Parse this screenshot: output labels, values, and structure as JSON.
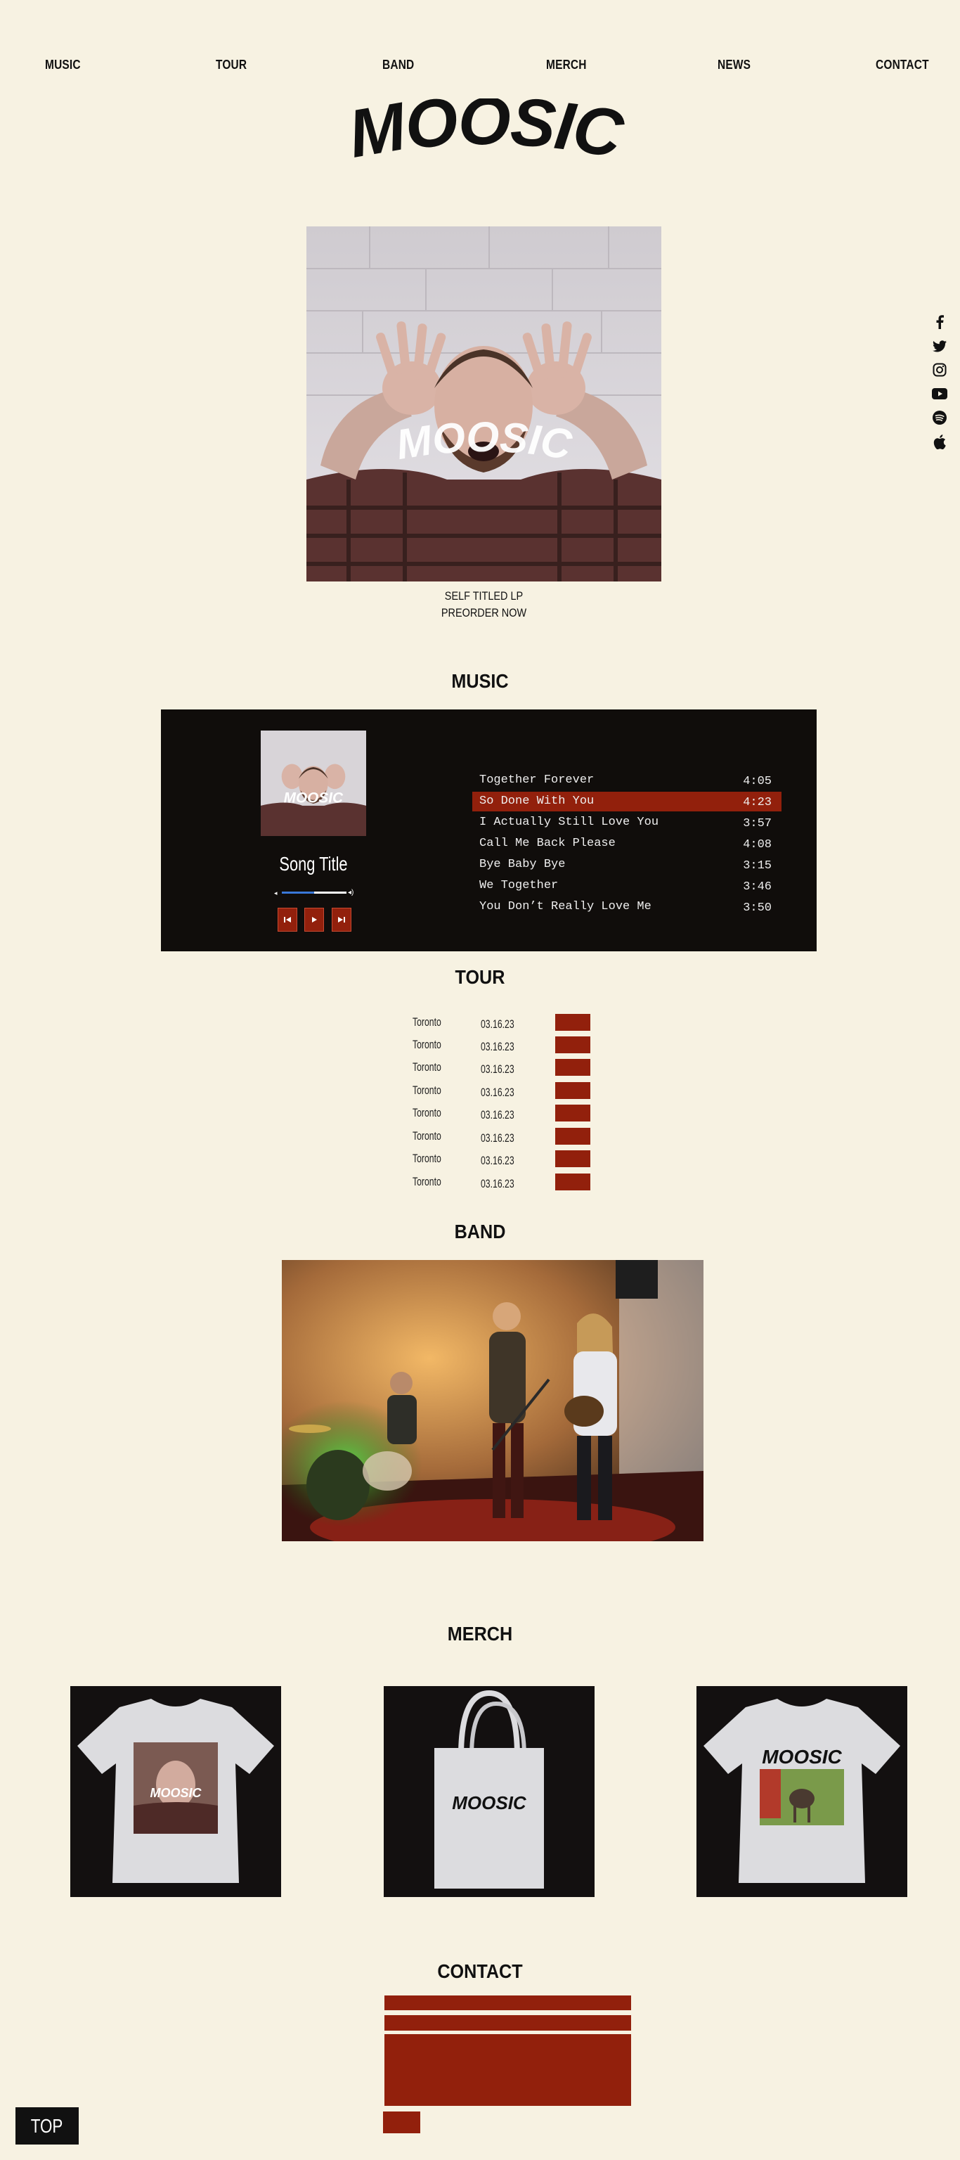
{
  "nav": {
    "items": [
      "MUSIC",
      "TOUR",
      "BAND",
      "MERCH",
      "NEWS",
      "CONTACT"
    ]
  },
  "brand": {
    "logo_text": "MOOSIC",
    "accent_color": "#92200c",
    "background": "#f7f2e2"
  },
  "social": {
    "icons": [
      "facebook-icon",
      "twitter-icon",
      "instagram-icon",
      "youtube-icon",
      "spotify-icon",
      "apple-icon"
    ]
  },
  "hero": {
    "image_overlay_text": "MOOSIC",
    "caption_line1": "SELF TITLED LP",
    "caption_line2": "PREORDER NOW"
  },
  "music": {
    "title": "MUSIC",
    "song_title": "Song Title",
    "progress": 0.5,
    "tracks": [
      {
        "title": "Together Forever",
        "duration": "4:05"
      },
      {
        "title": "So Done With You",
        "duration": "4:23",
        "active": true
      },
      {
        "title": "I Actually Still Love You",
        "duration": "3:57"
      },
      {
        "title": "Call Me Back Please",
        "duration": "4:08"
      },
      {
        "title": "Bye Baby Bye",
        "duration": "3:15"
      },
      {
        "title": "We Together",
        "duration": "3:46"
      },
      {
        "title": "You Don’t Really Love Me",
        "duration": "3:50"
      }
    ]
  },
  "tour": {
    "title": "TOUR",
    "dates": [
      {
        "city": "Toronto",
        "date": "03.16.23"
      },
      {
        "city": "Toronto",
        "date": "03.16.23"
      },
      {
        "city": "Toronto",
        "date": "03.16.23"
      },
      {
        "city": "Toronto",
        "date": "03.16.23"
      },
      {
        "city": "Toronto",
        "date": "03.16.23"
      },
      {
        "city": "Toronto",
        "date": "03.16.23"
      },
      {
        "city": "Toronto",
        "date": "03.16.23"
      },
      {
        "city": "Toronto",
        "date": "03.16.23"
      }
    ]
  },
  "band": {
    "title": "BAND"
  },
  "merch": {
    "title": "MERCH",
    "tote_text": "MOOSIC",
    "shirt_text": "MOOSIC"
  },
  "contact": {
    "title": "CONTACT"
  },
  "top_button": {
    "label": "TOP"
  }
}
